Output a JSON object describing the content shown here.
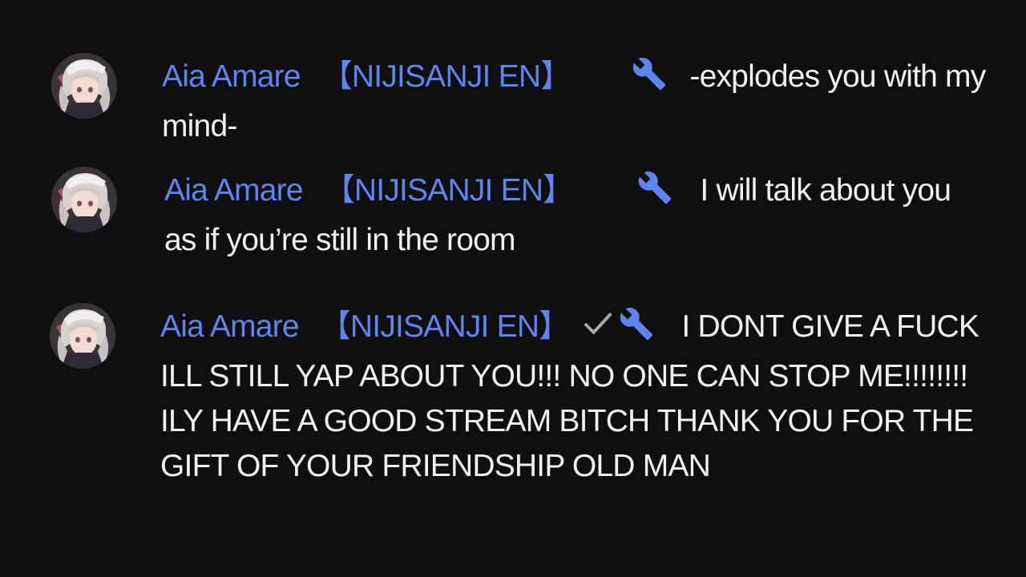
{
  "colors": {
    "background": "#0f0f0f",
    "author": "#5e84f1",
    "message_text": "#f1f1f1",
    "verified": "#aaaaaa"
  },
  "messages": [
    {
      "author": "Aia Amare",
      "channel_tag": "【NIJISANJI EN】",
      "verified": false,
      "badge_icon": "wrench-icon",
      "text": "-explodes you with my mind-"
    },
    {
      "author": "Aia Amare",
      "channel_tag": "【NIJISANJI EN】",
      "verified": false,
      "badge_icon": "wrench-icon",
      "text": "I will talk about you as if you’re still in the room"
    },
    {
      "author": "Aia Amare",
      "channel_tag": "【NIJISANJI EN】",
      "verified": true,
      "badge_icon": "wrench-icon",
      "text": "I DONT GIVE A FUCK ILL STILL YAP ABOUT YOU!!! NO ONE CAN STOP ME!!!!!!!! ILY HAVE A GOOD STREAM BITCH THANK YOU FOR THE GIFT OF YOUR FRIENDSHIP OLD MAN"
    }
  ]
}
